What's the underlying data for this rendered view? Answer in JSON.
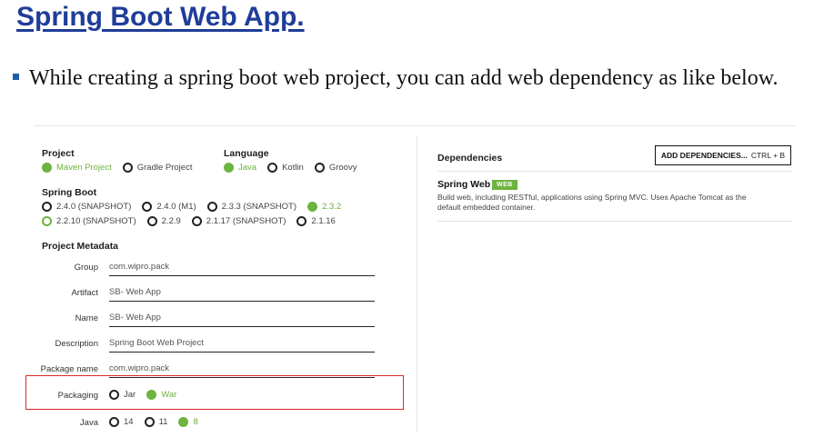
{
  "slide": {
    "title": "Spring Boot Web App.",
    "bullet": "While creating a spring boot web project, you can add web dependency as like below."
  },
  "initializr": {
    "project": {
      "label": "Project",
      "options": [
        {
          "label": "Maven Project",
          "selected": true
        },
        {
          "label": "Gradle Project",
          "selected": false
        }
      ]
    },
    "language": {
      "label": "Language",
      "options": [
        {
          "label": "Java",
          "selected": true
        },
        {
          "label": "Kotlin",
          "selected": false
        },
        {
          "label": "Groovy",
          "selected": false
        }
      ]
    },
    "spring_boot": {
      "label": "Spring Boot",
      "row1": [
        {
          "label": "2.4.0 (SNAPSHOT)",
          "selected": false
        },
        {
          "label": "2.4.0 (M1)",
          "selected": false
        },
        {
          "label": "2.3.3 (SNAPSHOT)",
          "selected": false
        },
        {
          "label": "2.3.2",
          "selected": true
        }
      ],
      "row2": [
        {
          "label": "2.2.10 (SNAPSHOT)",
          "selected": false
        },
        {
          "label": "2.2.9",
          "selected": false
        },
        {
          "label": "2.1.17 (SNAPSHOT)",
          "selected": false
        },
        {
          "label": "2.1.16",
          "selected": false
        }
      ]
    },
    "metadata": {
      "label": "Project Metadata",
      "fields": [
        {
          "label": "Group",
          "value": "com.wipro.pack"
        },
        {
          "label": "Artifact",
          "value": "SB- Web App"
        },
        {
          "label": "Name",
          "value": "SB- Web App"
        },
        {
          "label": "Description",
          "value": "Spring Boot Web Project"
        },
        {
          "label": "Package name",
          "value": "com.wipro.pack"
        }
      ]
    },
    "packaging": {
      "label": "Packaging",
      "options": [
        {
          "label": "Jar",
          "selected": false
        },
        {
          "label": "War",
          "selected": true
        }
      ]
    },
    "java": {
      "label": "Java",
      "options": [
        {
          "label": "14",
          "selected": false
        },
        {
          "label": "11",
          "selected": false
        },
        {
          "label": "8",
          "selected": true
        }
      ]
    },
    "dependencies": {
      "label": "Dependencies",
      "add_button": "ADD DEPENDENCIES...",
      "add_shortcut": "CTRL + B",
      "items": [
        {
          "name": "Spring Web",
          "badge": "WEB",
          "description": "Build web, including RESTful, applications using Spring MVC. Uses Apache Tomcat as the default embedded container."
        }
      ]
    }
  },
  "colors": {
    "accent": "#6db33f",
    "title": "#1f3d99",
    "highlight": "#d92a2a"
  }
}
